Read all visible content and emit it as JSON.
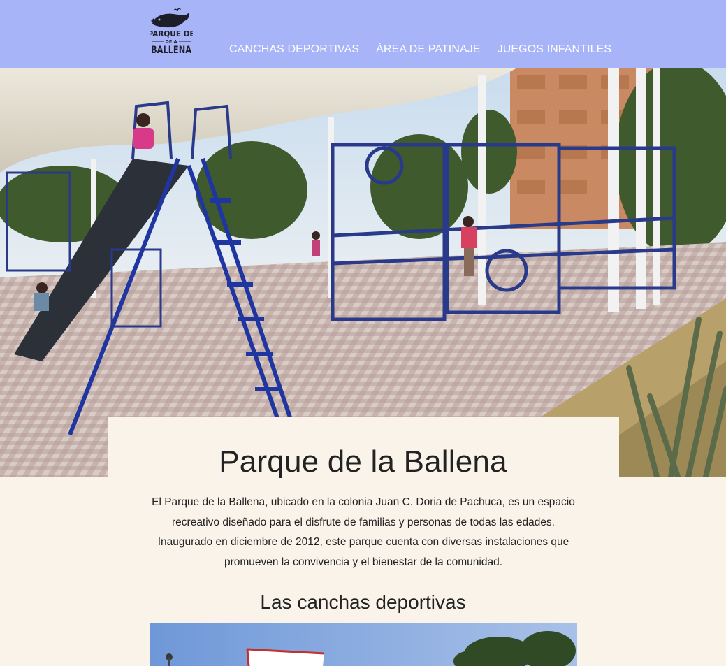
{
  "header": {
    "logo_text_top": "PARQUE DE",
    "logo_text_mid": "DE A",
    "logo_text_bottom": "BALLENA",
    "nav": [
      {
        "label": "CANCHAS DEPORTIVAS"
      },
      {
        "label": "ÁREA DE PATINAJE"
      },
      {
        "label": "JUEGOS INFANTILES"
      }
    ]
  },
  "main": {
    "title": "Parque de la Ballena",
    "intro": "El Parque de la Ballena, ubicado en la colonia Juan C. Doria de Pachuca, es un espacio recreativo diseñado para el disfrute de familias y personas de todas las edades. Inaugurado en diciembre de 2012, este parque cuenta con diversas instalaciones que promueven la convivencia y el bienestar de la comunidad.",
    "section_title": "Las canchas deportivas"
  },
  "colors": {
    "header_bg": "#a8b4f8",
    "page_bg": "#faf3ea",
    "text": "#222222",
    "nav_text": "#ffffff"
  }
}
